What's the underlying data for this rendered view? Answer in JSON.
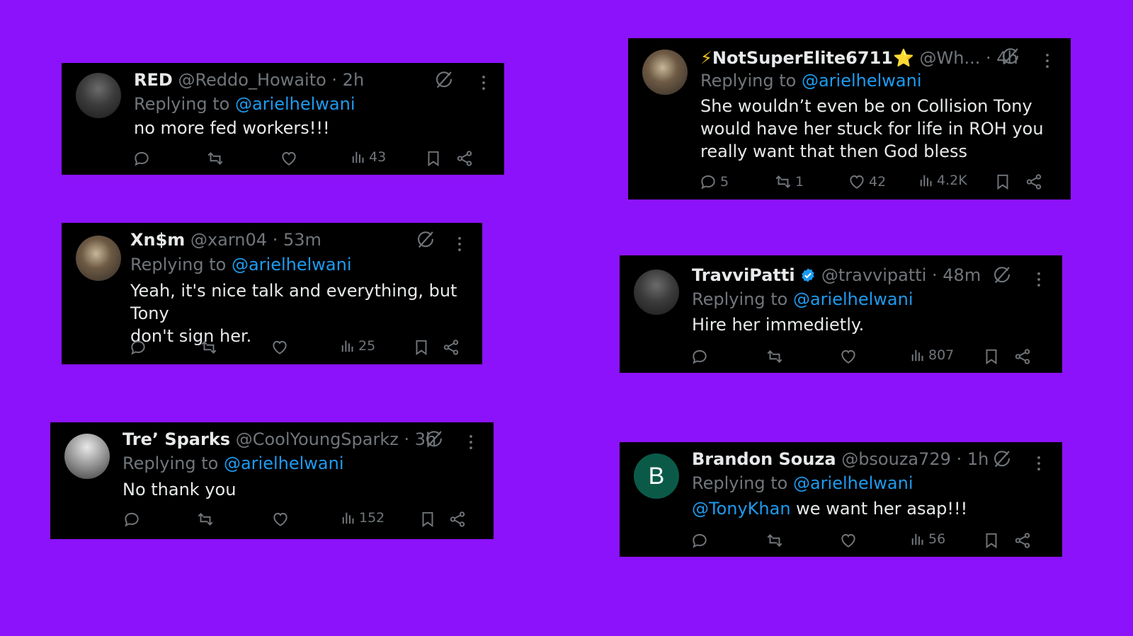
{
  "colors": {
    "background": "#8c12fb",
    "card": "#000000",
    "mention": "#1d9bf0",
    "muted": "#71767b",
    "verified": "#1d9bf0"
  },
  "replying_label": "Replying to",
  "icons": [
    "reply-icon",
    "retweet-icon",
    "like-icon",
    "views-icon",
    "bookmark-icon",
    "share-icon",
    "grok-icon",
    "more-icon",
    "verified-badge-icon"
  ],
  "tweets": [
    {
      "name": "RED",
      "handle": "@Reddo_Howaito",
      "time": "· 2h",
      "reply_to": "@arielhelwani",
      "text": "no more fed workers!!!",
      "replies": "",
      "retweets": "",
      "likes": "",
      "views": "43"
    },
    {
      "name": "Xn$m",
      "handle": "@xarn04",
      "time": "· 53m",
      "reply_to": "@arielhelwani",
      "text_line1": "Yeah, it's nice talk and everything, but Tony",
      "text_line2": "don't sign her.",
      "replies": "",
      "retweets": "",
      "likes": "",
      "views": "25"
    },
    {
      "name": "Tre’ Sparks",
      "handle": "@CoolYoungSparkz",
      "time": "· 3h",
      "reply_to": "@arielhelwani",
      "text": "No thank you",
      "replies": "",
      "retweets": "",
      "likes": "",
      "views": "152"
    },
    {
      "name_prefix": "⚡",
      "name": "NotSuperElite6711",
      "name_suffix": "⭐",
      "handle": "@Wh...",
      "time": "· 4h",
      "reply_to": "@arielhelwani",
      "text_line1": "She wouldn’t even be on Collision Tony",
      "text_line2": "would have her stuck for life in ROH you",
      "text_line3": "really want that then God bless",
      "replies": "5",
      "retweets": "1",
      "likes": "42",
      "views": "4.2K"
    },
    {
      "name": "TravviPatti",
      "handle": "@travvipatti",
      "time": "· 48m",
      "reply_to": "@arielhelwani",
      "text": "Hire her immedietly.",
      "replies": "",
      "retweets": "",
      "likes": "",
      "views": "807"
    },
    {
      "avatar_letter": "B",
      "name": "Brandon Souza",
      "handle": "@bsouza729",
      "time": "· 1h",
      "reply_to": "@arielhelwani",
      "text_mention": "@TonyKhan",
      "text": " we want her asap!!!",
      "replies": "",
      "retweets": "",
      "likes": "",
      "views": "56"
    }
  ]
}
